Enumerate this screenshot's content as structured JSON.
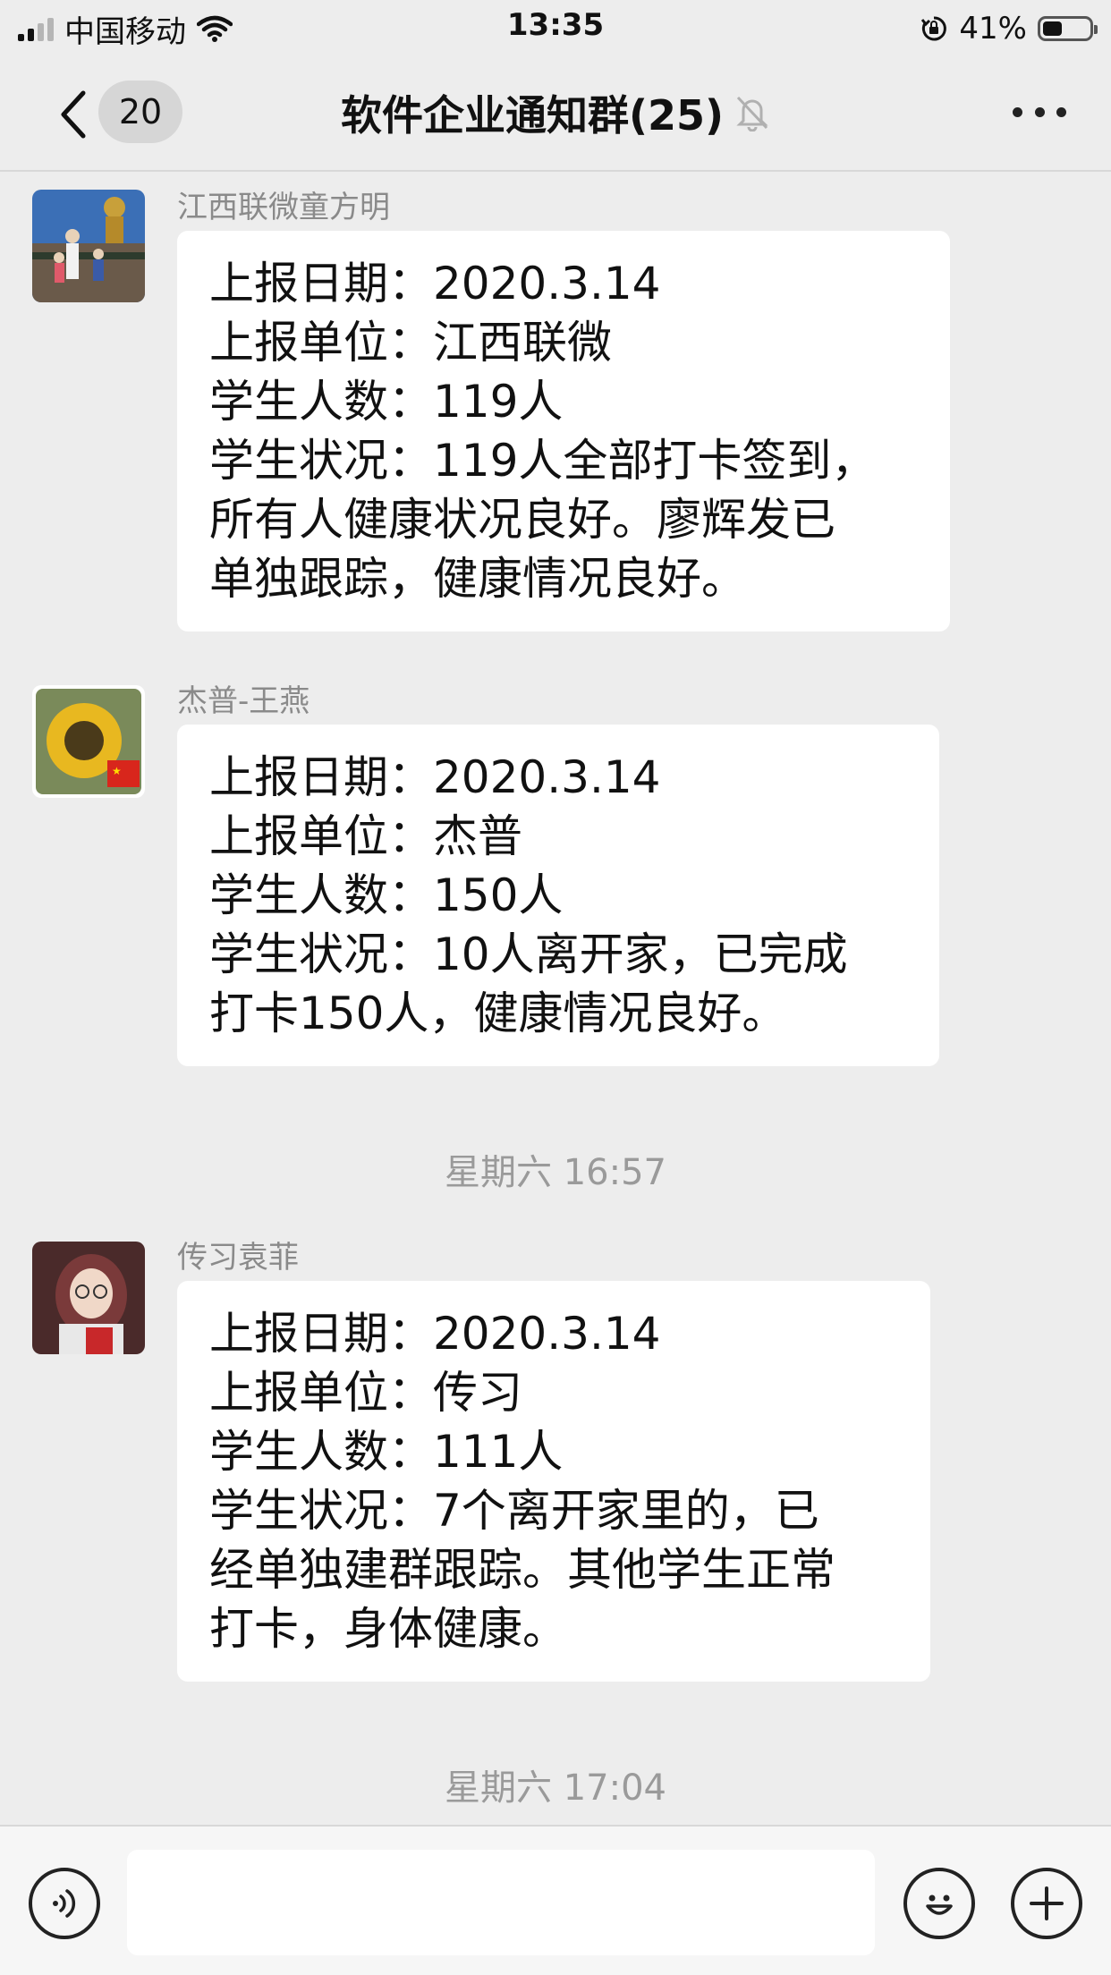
{
  "status_bar": {
    "carrier": "中国移动",
    "time": "13:35",
    "battery_percent": "41%",
    "battery_level": 0.41,
    "icons": [
      "signal-icon",
      "wifi-icon",
      "orientation-lock-icon",
      "battery-icon"
    ]
  },
  "nav": {
    "back_icon": "chevron-left-icon",
    "unread_count": "20",
    "title": "软件企业通知群(25)",
    "mute_icon": "bell-muted-icon",
    "more_icon": "more-icon"
  },
  "messages": [
    {
      "sender": "江西联微童方明",
      "lines": [
        "上报日期：2020.3.14",
        "上报单位：江西联微",
        "学生人数：119人",
        "学生状况：119人全部打卡签到，",
        "所有人健康状况良好。廖辉发已",
        "单独跟踪，健康情况良好。"
      ]
    },
    {
      "sender": "杰普-王燕",
      "lines": [
        "上报日期：2020.3.14",
        "上报单位：杰普",
        "学生人数：150人",
        "学生状况：10人离开家，已完成",
        "打卡150人，健康情况良好。"
      ]
    },
    {
      "timestamp": "星期六 16:57"
    },
    {
      "sender": "传习袁菲",
      "lines": [
        "上报日期：2020.3.14",
        "上报单位：传习",
        "学生人数：111人",
        "学生状况：7个离开家里的，已",
        "经单独建群跟踪。其他学生正常",
        "打卡，身体健康。"
      ]
    },
    {
      "timestamp": "星期六 17:04"
    }
  ],
  "input_bar": {
    "voice_icon": "voice-icon",
    "text_value": "",
    "emoji_icon": "emoji-icon",
    "plus_icon": "plus-icon"
  }
}
